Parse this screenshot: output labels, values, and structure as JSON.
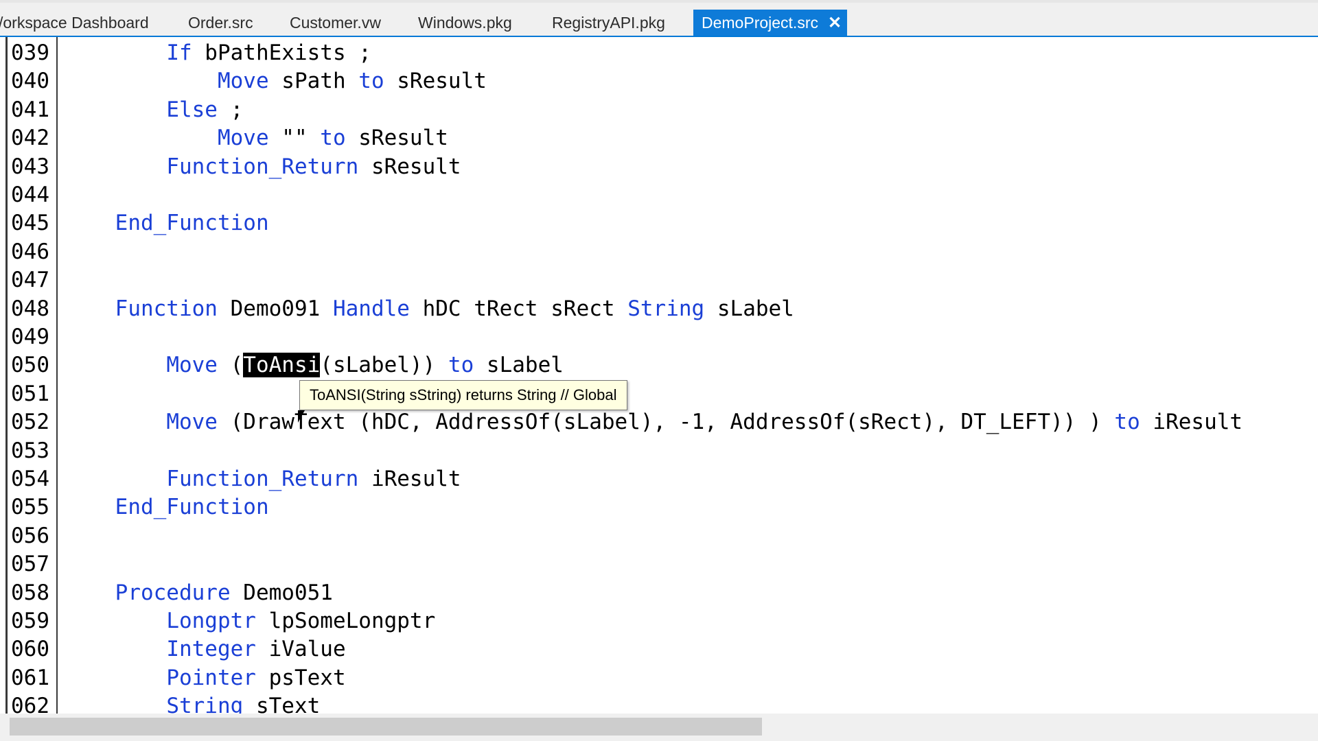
{
  "tabs": [
    {
      "label": "/orkspace Dashboard",
      "active": false
    },
    {
      "label": "Order.src",
      "active": false
    },
    {
      "label": "Customer.vw",
      "active": false
    },
    {
      "label": "Windows.pkg",
      "active": false
    },
    {
      "label": "RegistryAPI.pkg",
      "active": false
    },
    {
      "label": "DemoProject.src",
      "active": true,
      "close": "✕"
    }
  ],
  "lines": [
    {
      "num": "039",
      "indent": "        ",
      "tokens": [
        [
          "kw",
          "If"
        ],
        [
          "t",
          " bPathExists ;"
        ]
      ]
    },
    {
      "num": "040",
      "indent": "            ",
      "tokens": [
        [
          "kw",
          "Move"
        ],
        [
          "t",
          " sPath "
        ],
        [
          "kw",
          "to"
        ],
        [
          "t",
          " sResult"
        ]
      ]
    },
    {
      "num": "041",
      "indent": "        ",
      "tokens": [
        [
          "kw",
          "Else"
        ],
        [
          "t",
          " ;"
        ]
      ]
    },
    {
      "num": "042",
      "indent": "            ",
      "tokens": [
        [
          "kw",
          "Move"
        ],
        [
          "t",
          " \"\" "
        ],
        [
          "kw",
          "to"
        ],
        [
          "t",
          " sResult"
        ]
      ]
    },
    {
      "num": "043",
      "indent": "        ",
      "tokens": [
        [
          "kw",
          "Function_Return"
        ],
        [
          "t",
          " sResult"
        ]
      ]
    },
    {
      "num": "044",
      "indent": "",
      "tokens": []
    },
    {
      "num": "045",
      "indent": "    ",
      "tokens": [
        [
          "kw",
          "End_Function"
        ]
      ]
    },
    {
      "num": "046",
      "indent": "",
      "tokens": []
    },
    {
      "num": "047",
      "indent": "",
      "tokens": []
    },
    {
      "num": "048",
      "indent": "    ",
      "tokens": [
        [
          "kw",
          "Function"
        ],
        [
          "t",
          " Demo091 "
        ],
        [
          "kw",
          "Handle"
        ],
        [
          "t",
          " hDC tRect sRect "
        ],
        [
          "kw",
          "String"
        ],
        [
          "t",
          " sLabel"
        ]
      ]
    },
    {
      "num": "049",
      "indent": "",
      "tokens": []
    },
    {
      "num": "050",
      "indent": "        ",
      "tokens": [
        [
          "kw",
          "Move"
        ],
        [
          "t",
          " ("
        ],
        [
          "hl",
          "ToAnsi"
        ],
        [
          "t",
          "(sLabel)) "
        ],
        [
          "kw",
          "to"
        ],
        [
          "t",
          " sLabel"
        ]
      ]
    },
    {
      "num": "051",
      "indent": "",
      "tokens": []
    },
    {
      "num": "052",
      "indent": "        ",
      "tokens": [
        [
          "kw",
          "Move"
        ],
        [
          "t",
          " (DrawText (hDC, AddressOf(sLabel), -1, AddressOf(sRect), DT_LEFT)) ) "
        ],
        [
          "kw",
          "to"
        ],
        [
          "t",
          " iResult"
        ]
      ]
    },
    {
      "num": "053",
      "indent": "",
      "tokens": []
    },
    {
      "num": "054",
      "indent": "        ",
      "tokens": [
        [
          "kw",
          "Function_Return"
        ],
        [
          "t",
          " iResult"
        ]
      ]
    },
    {
      "num": "055",
      "indent": "    ",
      "tokens": [
        [
          "kw",
          "End_Function"
        ]
      ]
    },
    {
      "num": "056",
      "indent": "",
      "tokens": []
    },
    {
      "num": "057",
      "indent": "",
      "tokens": []
    },
    {
      "num": "058",
      "indent": "    ",
      "tokens": [
        [
          "kw",
          "Procedure"
        ],
        [
          "t",
          " Demo051"
        ]
      ]
    },
    {
      "num": "059",
      "indent": "        ",
      "tokens": [
        [
          "kw",
          "Longptr"
        ],
        [
          "t",
          " lpSomeLongptr"
        ]
      ]
    },
    {
      "num": "060",
      "indent": "        ",
      "tokens": [
        [
          "kw",
          "Integer"
        ],
        [
          "t",
          " iValue"
        ]
      ]
    },
    {
      "num": "061",
      "indent": "        ",
      "tokens": [
        [
          "kw",
          "Pointer"
        ],
        [
          "t",
          " psText"
        ]
      ]
    },
    {
      "num": "062",
      "indent": "        ",
      "tokens": [
        [
          "kw",
          "String"
        ],
        [
          "t",
          " sText"
        ]
      ]
    }
  ],
  "tooltip": {
    "text": "ToANSI(String sString) returns String // Global"
  },
  "colors": {
    "keyword": "#1a3fd6",
    "tab_active": "#0e7bd8",
    "tooltip_bg": "#ffffe1"
  }
}
